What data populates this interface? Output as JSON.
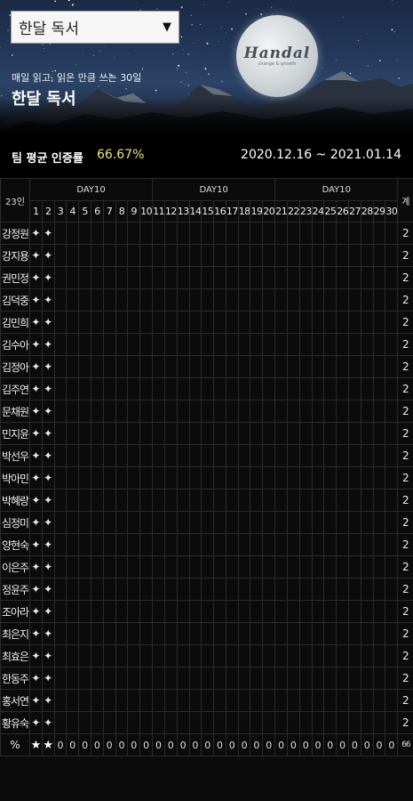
{
  "header": {
    "select_value": "한달 독서",
    "subtitle": "매일 읽고, 읽은 만큼 쓰는 30일",
    "title": "한달 독서",
    "logo_text": "Handal",
    "logo_tagline": "change & growth"
  },
  "stats": {
    "label": "팀 평균 인증률",
    "value": "66.67%",
    "period": "2020.12.16 ~ 2021.01.14"
  },
  "table": {
    "count_label": "23인",
    "week_labels": [
      "DAY10",
      "DAY10",
      "DAY10"
    ],
    "sum_label": "계",
    "days": [
      "1",
      "2",
      "3",
      "4",
      "5",
      "6",
      "7",
      "8",
      "9",
      "10",
      "11",
      "12",
      "13",
      "14",
      "15",
      "16",
      "17",
      "18",
      "19",
      "20",
      "21",
      "22",
      "23",
      "24",
      "25",
      "26",
      "27",
      "28",
      "29",
      "30"
    ],
    "check_mark": "✦",
    "members": [
      {
        "name": "강정원",
        "checks": [
          true,
          true
        ],
        "total": "2"
      },
      {
        "name": "강지용",
        "checks": [
          true,
          true
        ],
        "total": "2"
      },
      {
        "name": "권민정",
        "checks": [
          true,
          true
        ],
        "total": "2"
      },
      {
        "name": "김덕중",
        "checks": [
          true,
          true
        ],
        "total": "2"
      },
      {
        "name": "김민희",
        "checks": [
          true,
          true
        ],
        "total": "2"
      },
      {
        "name": "김수아",
        "checks": [
          true,
          true
        ],
        "total": "2"
      },
      {
        "name": "김정아",
        "checks": [
          true,
          true
        ],
        "total": "2"
      },
      {
        "name": "김주연",
        "checks": [
          true,
          true
        ],
        "total": "2"
      },
      {
        "name": "문채원",
        "checks": [
          true,
          true
        ],
        "total": "2"
      },
      {
        "name": "민지윤",
        "checks": [
          true,
          true
        ],
        "total": "2"
      },
      {
        "name": "박선우",
        "checks": [
          true,
          true
        ],
        "total": "2"
      },
      {
        "name": "박아민",
        "checks": [
          true,
          true
        ],
        "total": "2"
      },
      {
        "name": "박혜랑",
        "checks": [
          true,
          true
        ],
        "total": "2"
      },
      {
        "name": "심정미",
        "checks": [
          true,
          true
        ],
        "total": "2"
      },
      {
        "name": "양현숙",
        "checks": [
          true,
          true
        ],
        "total": "2"
      },
      {
        "name": "이은주",
        "checks": [
          true,
          true
        ],
        "total": "2"
      },
      {
        "name": "정윤주",
        "checks": [
          true,
          true
        ],
        "total": "2"
      },
      {
        "name": "조아라",
        "checks": [
          true,
          true
        ],
        "total": "2"
      },
      {
        "name": "최은지",
        "checks": [
          true,
          true
        ],
        "total": "2"
      },
      {
        "name": "최효은",
        "checks": [
          true,
          true
        ],
        "total": "2"
      },
      {
        "name": "한동주",
        "checks": [
          true,
          true
        ],
        "total": "2"
      },
      {
        "name": "홍서연",
        "checks": [
          true,
          true
        ],
        "total": "2"
      },
      {
        "name": "황유숙",
        "checks": [
          true,
          true
        ],
        "total": "2"
      }
    ],
    "percent_row": {
      "label": "%",
      "star_mark": "★",
      "stars": 2,
      "zero_mark": "0",
      "total": "66"
    }
  },
  "colors": {
    "accent_yellow": "#ece878",
    "background": "#0b0b0b",
    "grid_line": "#2b2b2b"
  }
}
